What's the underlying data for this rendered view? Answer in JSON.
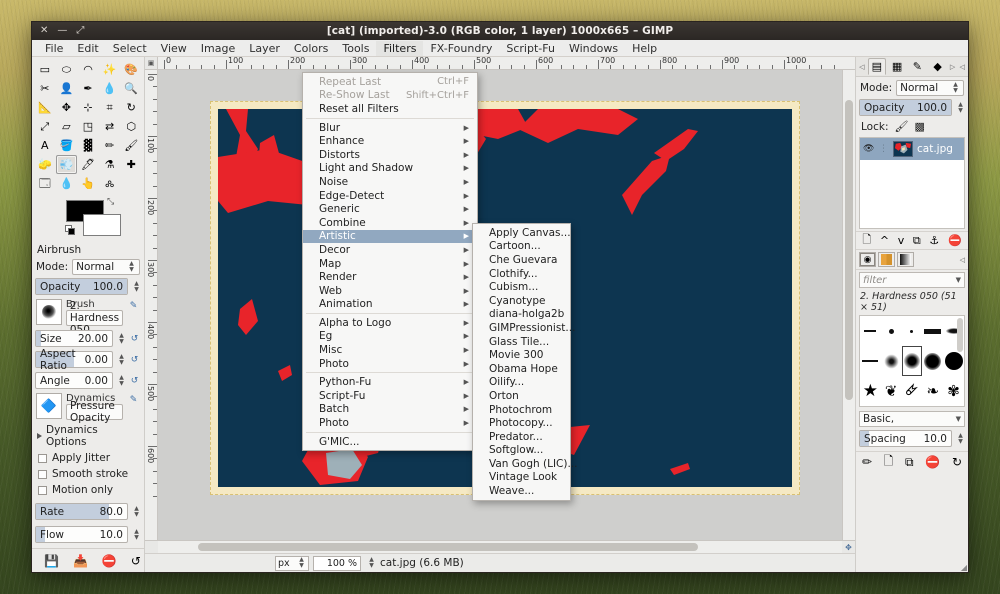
{
  "window": {
    "title": "[cat] (imported)-3.0 (RGB color, 1 layer) 1000x665 – GIMP",
    "buttons": {
      "close": "✕",
      "minimize": "—",
      "maximize": "⤢"
    }
  },
  "menubar": {
    "items": [
      {
        "label": "File"
      },
      {
        "label": "Edit"
      },
      {
        "label": "Select"
      },
      {
        "label": "View"
      },
      {
        "label": "Image"
      },
      {
        "label": "Layer"
      },
      {
        "label": "Colors"
      },
      {
        "label": "Tools"
      },
      {
        "label": "Filters",
        "open": true
      },
      {
        "label": "FX-Foundry"
      },
      {
        "label": "Script-Fu"
      },
      {
        "label": "Windows"
      },
      {
        "label": "Help"
      }
    ]
  },
  "filters_menu": {
    "items": [
      {
        "label": "Repeat Last",
        "accel": "Ctrl+F",
        "disabled": true,
        "submenu": false
      },
      {
        "label": "Re-Show Last",
        "accel": "Shift+Ctrl+F",
        "disabled": true,
        "submenu": false
      },
      {
        "label": "Reset all Filters",
        "accel": "",
        "disabled": false,
        "submenu": false
      },
      {
        "separator": true
      },
      {
        "label": "Blur",
        "submenu": true
      },
      {
        "label": "Enhance",
        "submenu": true
      },
      {
        "label": "Distorts",
        "submenu": true
      },
      {
        "label": "Light and Shadow",
        "submenu": true
      },
      {
        "label": "Noise",
        "submenu": true
      },
      {
        "label": "Edge-Detect",
        "submenu": true
      },
      {
        "label": "Generic",
        "submenu": true
      },
      {
        "label": "Combine",
        "submenu": true
      },
      {
        "label": "Artistic",
        "submenu": true,
        "highlighted": true
      },
      {
        "label": "Decor",
        "submenu": true
      },
      {
        "label": "Map",
        "submenu": true
      },
      {
        "label": "Render",
        "submenu": true
      },
      {
        "label": "Web",
        "submenu": true
      },
      {
        "label": "Animation",
        "submenu": true
      },
      {
        "separator": true
      },
      {
        "label": "Alpha to Logo",
        "submenu": true
      },
      {
        "label": "Eg",
        "submenu": true
      },
      {
        "label": "Misc",
        "submenu": true
      },
      {
        "label": "Photo",
        "submenu": true
      },
      {
        "separator": true
      },
      {
        "label": "Python-Fu",
        "submenu": true
      },
      {
        "label": "Script-Fu",
        "submenu": true
      },
      {
        "label": "Batch",
        "submenu": true
      },
      {
        "label": "Photo",
        "submenu": true
      },
      {
        "separator": true
      },
      {
        "label": "G'MIC...",
        "submenu": false
      }
    ]
  },
  "artistic_menu": {
    "items": [
      {
        "label": "Apply Canvas..."
      },
      {
        "label": "Cartoon..."
      },
      {
        "label": "Che Guevara"
      },
      {
        "label": "Clothify..."
      },
      {
        "label": "Cubism..."
      },
      {
        "label": "Cyanotype"
      },
      {
        "label": "diana-holga2b"
      },
      {
        "label": "GIMPressionist..."
      },
      {
        "label": "Glass Tile..."
      },
      {
        "label": "Movie 300"
      },
      {
        "label": "Obama Hope"
      },
      {
        "label": "Oilify..."
      },
      {
        "label": "Orton"
      },
      {
        "label": "Photochrom"
      },
      {
        "label": "Photocopy..."
      },
      {
        "label": "Predator..."
      },
      {
        "label": "Softglow..."
      },
      {
        "label": "Van Gogh (LIC)..."
      },
      {
        "label": "Vintage Look"
      },
      {
        "label": "Weave..."
      }
    ]
  },
  "toolbox": {
    "tools": [
      {
        "name": "rect-select-tool",
        "glyph": "▭"
      },
      {
        "name": "ellipse-select-tool",
        "glyph": "⬭"
      },
      {
        "name": "free-select-tool",
        "glyph": "◠"
      },
      {
        "name": "fuzzy-select-tool",
        "glyph": "✨"
      },
      {
        "name": "select-by-color-tool",
        "glyph": "🎨"
      },
      {
        "name": "scissors-select-tool",
        "glyph": "✂"
      },
      {
        "name": "foreground-select-tool",
        "glyph": "👤"
      },
      {
        "name": "paths-tool",
        "glyph": "✒"
      },
      {
        "name": "color-picker-tool",
        "glyph": "💧"
      },
      {
        "name": "zoom-tool",
        "glyph": "🔍"
      },
      {
        "name": "measure-tool",
        "glyph": "📐"
      },
      {
        "name": "move-tool",
        "glyph": "✥"
      },
      {
        "name": "alignment-tool",
        "glyph": "⊹"
      },
      {
        "name": "crop-tool",
        "glyph": "⌗"
      },
      {
        "name": "rotate-tool",
        "glyph": "↻"
      },
      {
        "name": "scale-tool",
        "glyph": "⤢"
      },
      {
        "name": "shear-tool",
        "glyph": "▱"
      },
      {
        "name": "perspective-tool",
        "glyph": "◳"
      },
      {
        "name": "flip-tool",
        "glyph": "⇄"
      },
      {
        "name": "cage-transform-tool",
        "glyph": "⬡"
      },
      {
        "name": "text-tool",
        "glyph": "A"
      },
      {
        "name": "bucket-fill-tool",
        "glyph": "🪣"
      },
      {
        "name": "blend-tool",
        "glyph": "▓"
      },
      {
        "name": "pencil-tool",
        "glyph": "✏"
      },
      {
        "name": "paintbrush-tool",
        "glyph": "🖌"
      },
      {
        "name": "eraser-tool",
        "glyph": "🧽"
      },
      {
        "name": "airbrush-tool",
        "glyph": "💨",
        "selected": true
      },
      {
        "name": "ink-tool",
        "glyph": "🖊"
      },
      {
        "name": "clone-tool",
        "glyph": "⚗"
      },
      {
        "name": "heal-tool",
        "glyph": "✚"
      },
      {
        "name": "perspective-clone-tool",
        "glyph": "🗔"
      },
      {
        "name": "blur-sharpen-tool",
        "glyph": "💧"
      },
      {
        "name": "smudge-tool",
        "glyph": "👆"
      },
      {
        "name": "dodge-burn-tool",
        "glyph": "🝆"
      }
    ],
    "colors": {
      "foreground": "#000000",
      "background": "#ffffff"
    }
  },
  "tool_options": {
    "tool_name": "Airbrush",
    "mode_label": "Mode:",
    "mode_value": "Normal",
    "opacity_label": "Opacity",
    "opacity_value": "100.0",
    "brush_label": "Brush",
    "brush_value": "2. Hardness 050",
    "size_label": "Size",
    "size_value": "20.00",
    "aspect_label": "Aspect Ratio",
    "aspect_value": "0.00",
    "angle_label": "Angle",
    "angle_value": "0.00",
    "dynamics_label": "Dynamics",
    "dynamics_value": "Pressure Opacity",
    "dynamics_options_label": "Dynamics Options",
    "apply_jitter_label": "Apply Jitter",
    "smooth_stroke_label": "Smooth stroke",
    "motion_only_label": "Motion only",
    "rate_label": "Rate",
    "rate_value": "80.0",
    "flow_label": "Flow",
    "flow_value": "10.0"
  },
  "tool_options_bottom_icons": [
    {
      "name": "save-tool-options-icon",
      "glyph": "💾"
    },
    {
      "name": "restore-tool-options-icon",
      "glyph": "📥"
    },
    {
      "name": "delete-tool-options-icon",
      "glyph": "⛔"
    },
    {
      "name": "reset-tool-options-icon",
      "glyph": "↺"
    }
  ],
  "layers_panel": {
    "tabs": [
      {
        "name": "tab-layers",
        "glyph": "▤",
        "active": true
      },
      {
        "name": "tab-channels",
        "glyph": "▦"
      },
      {
        "name": "tab-paths",
        "glyph": "✎"
      },
      {
        "name": "tab-undo-history",
        "glyph": "◆"
      }
    ],
    "mode_label": "Mode:",
    "mode_value": "Normal",
    "opacity_label": "Opacity",
    "opacity_value": "100.0",
    "lock_label": "Lock:",
    "layers": [
      {
        "name": "cat.jpg",
        "visible": true,
        "selected": true
      }
    ],
    "toolbar_icons": [
      {
        "name": "new-layer-icon",
        "glyph": "🗋"
      },
      {
        "name": "raise-layer-icon",
        "glyph": "^"
      },
      {
        "name": "lower-layer-icon",
        "glyph": "v"
      },
      {
        "name": "duplicate-layer-icon",
        "glyph": "⧉"
      },
      {
        "name": "anchor-layer-icon",
        "glyph": "⚓"
      },
      {
        "name": "delete-layer-icon",
        "glyph": "⛔"
      }
    ]
  },
  "brushes_panel": {
    "filter_placeholder": "filter",
    "caption": "2. Hardness 050 (51 × 51)",
    "list_mode_label": "Basic,",
    "spacing_label": "Spacing",
    "spacing_value": "10.0",
    "bottom_icons": [
      {
        "name": "edit-brush-icon",
        "glyph": "✏"
      },
      {
        "name": "new-brush-icon",
        "glyph": "🗋"
      },
      {
        "name": "duplicate-brush-icon",
        "glyph": "⧉"
      },
      {
        "name": "delete-brush-icon",
        "glyph": "⛔"
      },
      {
        "name": "refresh-brushes-icon",
        "glyph": "↻"
      }
    ]
  },
  "rulers": {
    "unit": "px",
    "h_ticks": [
      "0",
      "100",
      "200",
      "300",
      "400",
      "500",
      "600",
      "700",
      "800",
      "900",
      "1000"
    ],
    "v_ticks": [
      "0",
      "100",
      "200",
      "300",
      "400",
      "500",
      "600"
    ]
  },
  "statusbar": {
    "unit": "px",
    "zoom": "100 %",
    "info": "cat.jpg (6.6 MB)"
  },
  "canvas": {
    "image_name": "cat.jpg",
    "colors": {
      "dark_blue": "#0d3550",
      "red": "#e8242a",
      "gray_blue": "#9eb0b8",
      "cream": "#f5e2b4",
      "canvas_bg": "#cfcfcd",
      "border": "#d9c173"
    }
  }
}
